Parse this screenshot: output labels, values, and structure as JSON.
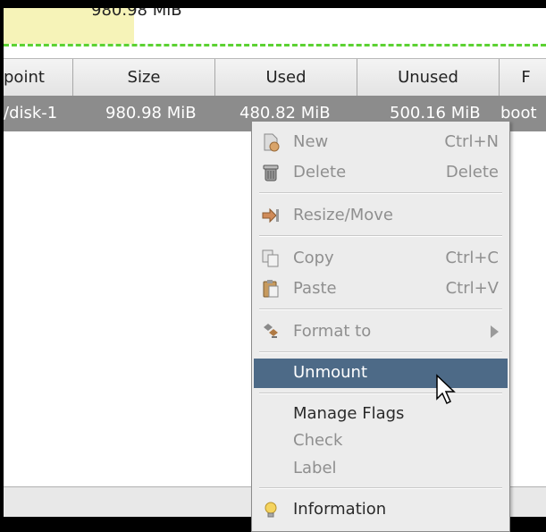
{
  "partition_graph": {
    "size_label": "980.98 MiB"
  },
  "table": {
    "columns": [
      "point",
      "Size",
      "Used",
      "Unused",
      "F"
    ],
    "selected_row": {
      "mountpoint": "/disk-1",
      "size": "980.98 MiB",
      "used": "480.82 MiB",
      "unused": "500.16 MiB",
      "flags": "boot"
    }
  },
  "menu": {
    "new": {
      "label": "New",
      "accel": "Ctrl+N"
    },
    "delete": {
      "label": "Delete",
      "accel": "Delete"
    },
    "resize": {
      "label": "Resize/Move"
    },
    "copy": {
      "label": "Copy",
      "accel": "Ctrl+C"
    },
    "paste": {
      "label": "Paste",
      "accel": "Ctrl+V"
    },
    "format": {
      "label": "Format to"
    },
    "unmount": {
      "label": "Unmount"
    },
    "manage_flags": {
      "label": "Manage Flags"
    },
    "check": {
      "label": "Check"
    },
    "label": {
      "label": "Label"
    },
    "information": {
      "label": "Information"
    }
  },
  "colors": {
    "highlight": "#4d6a87",
    "selected_row": "#8c8c8c",
    "partition_fill": "#f6f3b8",
    "partition_border": "#5cd233"
  }
}
